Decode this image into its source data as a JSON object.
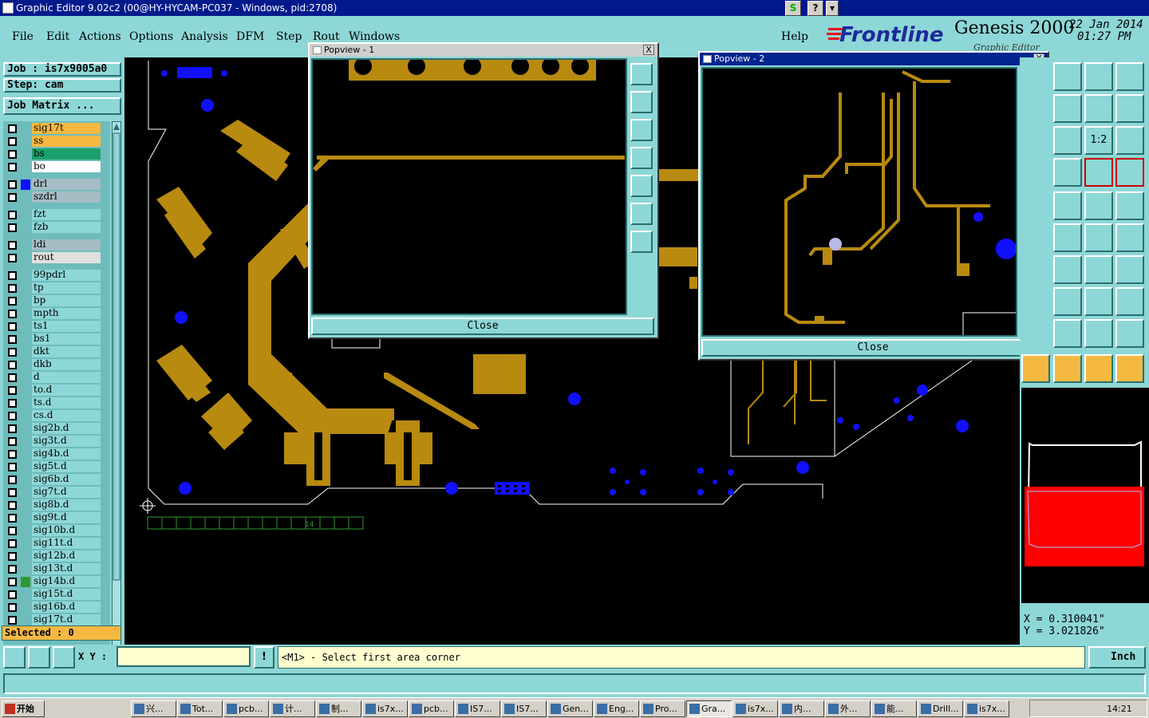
{
  "window": {
    "title": "Graphic Editor 9.02c2 (00@HY-HYCAM-PC037 - Windows, pid:2708)",
    "btn_s": "S",
    "btn_help": "?",
    "btn_menu": "▾"
  },
  "menu": {
    "items": [
      "File",
      "Edit",
      "Actions",
      "Options",
      "Analysis",
      "DFM",
      "Step",
      "Rout",
      "Windows"
    ],
    "help": "Help"
  },
  "brand": {
    "logo": "Frontline",
    "product": "Genesis 2000",
    "date": "22 Jan 2014",
    "time": "01:27 PM",
    "subtitle": "Graphic Editor"
  },
  "job": {
    "job_label": "Job : is7x9005a0",
    "step_label": "Step: cam",
    "matrix_button": "Job Matrix ..."
  },
  "layers": [
    {
      "name": "sig17t",
      "bg": "#f5b942",
      "swatch": ""
    },
    {
      "name": "ss",
      "bg": "#f5b942",
      "swatch": ""
    },
    {
      "name": "bs",
      "bg": "#1aa06a",
      "swatch": ""
    },
    {
      "name": "bo",
      "bg": "#ffffff",
      "swatch": ""
    },
    {
      "name": "drl",
      "bg": "#a7bcc4",
      "swatch": "#1010ff"
    },
    {
      "name": "szdrl",
      "bg": "#a7bcc4",
      "swatch": ""
    },
    {
      "name": "fzt",
      "bg": "#8ed7d7",
      "swatch": ""
    },
    {
      "name": "fzb",
      "bg": "#8ed7d7",
      "swatch": ""
    },
    {
      "name": "ldi",
      "bg": "#a7bcc4",
      "swatch": ""
    },
    {
      "name": "rout",
      "bg": "#e0e0e0",
      "swatch": ""
    },
    {
      "name": "99pdrl",
      "bg": "#8ed7d7",
      "swatch": ""
    },
    {
      "name": "tp",
      "bg": "#8ed7d7",
      "swatch": ""
    },
    {
      "name": "bp",
      "bg": "#8ed7d7",
      "swatch": ""
    },
    {
      "name": "mpth",
      "bg": "#8ed7d7",
      "swatch": ""
    },
    {
      "name": "ts1",
      "bg": "#8ed7d7",
      "swatch": ""
    },
    {
      "name": "bs1",
      "bg": "#8ed7d7",
      "swatch": ""
    },
    {
      "name": "dkt",
      "bg": "#8ed7d7",
      "swatch": ""
    },
    {
      "name": "dkb",
      "bg": "#8ed7d7",
      "swatch": ""
    },
    {
      "name": "d",
      "bg": "#8ed7d7",
      "swatch": ""
    },
    {
      "name": "to.d",
      "bg": "#8ed7d7",
      "swatch": ""
    },
    {
      "name": "ts.d",
      "bg": "#8ed7d7",
      "swatch": ""
    },
    {
      "name": "cs.d",
      "bg": "#8ed7d7",
      "swatch": ""
    },
    {
      "name": "sig2b.d",
      "bg": "#8ed7d7",
      "swatch": ""
    },
    {
      "name": "sig3t.d",
      "bg": "#8ed7d7",
      "swatch": ""
    },
    {
      "name": "sig4b.d",
      "bg": "#8ed7d7",
      "swatch": ""
    },
    {
      "name": "sig5t.d",
      "bg": "#8ed7d7",
      "swatch": ""
    },
    {
      "name": "sig6b.d",
      "bg": "#8ed7d7",
      "swatch": ""
    },
    {
      "name": "sig7t.d",
      "bg": "#8ed7d7",
      "swatch": ""
    },
    {
      "name": "sig8b.d",
      "bg": "#8ed7d7",
      "swatch": ""
    },
    {
      "name": "sig9t.d",
      "bg": "#8ed7d7",
      "swatch": ""
    },
    {
      "name": "sig10b.d",
      "bg": "#8ed7d7",
      "swatch": ""
    },
    {
      "name": "sig11t.d",
      "bg": "#8ed7d7",
      "swatch": ""
    },
    {
      "name": "sig12b.d",
      "bg": "#8ed7d7",
      "swatch": ""
    },
    {
      "name": "sig13t.d",
      "bg": "#8ed7d7",
      "swatch": ""
    },
    {
      "name": "sig14b.d",
      "bg": "#8ed7d7",
      "swatch": "#2e9a2e"
    },
    {
      "name": "sig15t.d",
      "bg": "#8ed7d7",
      "swatch": ""
    },
    {
      "name": "sig16b.d",
      "bg": "#8ed7d7",
      "swatch": ""
    },
    {
      "name": "sig17t.d",
      "bg": "#8ed7d7",
      "swatch": ""
    }
  ],
  "selected_label": "Selected : 0",
  "canvas": {
    "ruler_label": "14"
  },
  "popview1": {
    "title": "Popview - 1",
    "close": "Close",
    "x": "X"
  },
  "popview2": {
    "title": "Popview - 2",
    "close": "Close",
    "x": "X"
  },
  "tools": {
    "zoom_ratio": "1:2"
  },
  "coords": {
    "x": "X = 0.310041\"",
    "y": "Y = 3.021826\""
  },
  "status": {
    "xy_label": "X Y :",
    "xy_value": "",
    "bang": "!",
    "message": "<M1> - Select first area corner",
    "units": "Inch"
  },
  "taskbar": {
    "start": "开始",
    "tasks": [
      "兴...",
      "Tot...",
      "pcb...",
      "计...",
      "制...",
      "is7x...",
      "pcb...",
      "IS7...",
      "IS7...",
      "Gen...",
      "Eng...",
      "Pro...",
      "Gra...",
      "is7x...",
      "内...",
      "外...",
      "能...",
      "Drill...",
      "is7x..."
    ],
    "clock": "14:21"
  },
  "colors": {
    "panel": "#8ed7d7",
    "trace": "#b88a0f",
    "drill": "#1010ff",
    "outline": "#ffffff"
  }
}
